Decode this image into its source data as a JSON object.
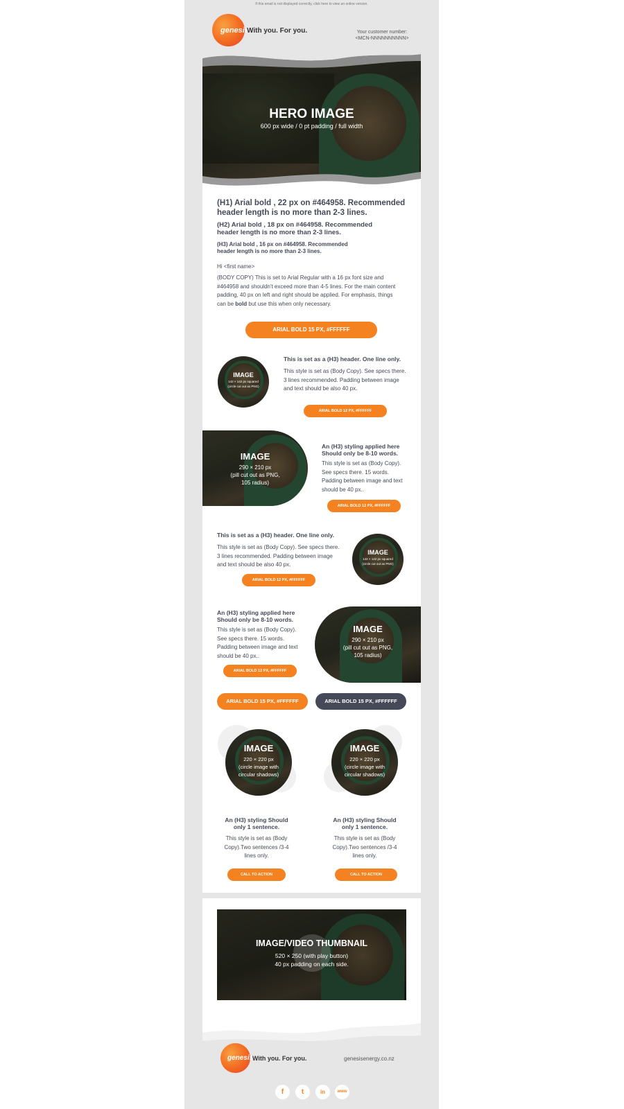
{
  "preheader": "If this email is not displayed correctly, click here to view an online version.",
  "brand": {
    "logo_text": "genesis",
    "tagline": "With you. For you.",
    "orange": "#f58220",
    "slate": "#464958"
  },
  "customer": {
    "label": "Your customer number:",
    "value": "<MCN-NNNNNNNNNN>"
  },
  "hero": {
    "title": "HERO IMAGE",
    "subtitle": "600 px wide / 0 pt padding / full width"
  },
  "headings": {
    "h1": "(H1) Arial bold , 22 px on #464958. Recommended header length is no more than 2-3 lines.",
    "h2": "(H2) Arial bold , 18 px on #464958. Recommended header length is no more than 2-3 lines.",
    "h3": "(H3) Arial bold , 16 px on #464958. Recommended header length is no more than 2-3 lines."
  },
  "greeting": "Hi <first name>",
  "body": {
    "before_bold": "(BODY COPY) This is set to Arial Regular with a 16 px font size and #464958 and shouldn't exceed more than 4-5 lines. For the main content padding, 40 px on left and right should be applied. For emphasis, things can be ",
    "bold": "bold",
    "after_bold": " but use this when only necessary."
  },
  "main_cta": "ARIAL BOLD 15 PX, #FFFFFF",
  "row1": {
    "img_title": "IMAGE",
    "img_sub1": "142 × 142 px squared",
    "img_sub2": "(circle cut out as PNG)",
    "h3": "This is set as a (H3) header. One line only.",
    "body": "This style is set as (Body Copy). See specs there. 3 lines recommended. Padding between image and text should be also 40 px.",
    "cta": "ARIAL BOLD 12 PX, #FFFFFF"
  },
  "row2": {
    "img_title": "IMAGE",
    "img_sub1": "290 × 210 px",
    "img_sub2": "(pill cut out as PNG,",
    "img_sub3": "105 radius)",
    "h3": "An (H3) styling applied here Should only be 8-10 words.",
    "body": "This style is set as (Body Copy). See specs there. 15 words. Padding between image and text should be 40 px..",
    "cta": "ARIAL BOLD 12 PX, #FFFFFF"
  },
  "row3": {
    "img_title": "IMAGE",
    "img_sub1": "142 × 142 px squared",
    "img_sub2": "(circle cut out as PNG)",
    "h3": "This is set as a (H3) header. One line only.",
    "body": "This style is set as (Body Copy). See specs there. 3 lines recommended. Padding between image and text should be also 40 px.",
    "cta": "ARIAL BOLD 12 PX, #FFFFFF"
  },
  "row4": {
    "img_title": "IMAGE",
    "img_sub1": "290 × 210 px",
    "img_sub2": "(pill cut out as PNG,",
    "img_sub3": "105 radius)",
    "h3": "An (H3) styling applied here Should only be 8-10 words.",
    "body": "This style is set as (Body Copy). See specs there. 15 words. Padding between image and text should be 40 px..",
    "cta": "ARIAL BOLD 12 PX, #FFFFFF"
  },
  "dual_buttons": {
    "primary": "ARIAL BOLD 15 PX, #FFFFFF",
    "secondary": "ARIAL BOLD 15 PX, #FFFFFF"
  },
  "columns": [
    {
      "img_title": "IMAGE",
      "img_sub1": "220 × 220 px",
      "img_sub2": "(circle image with",
      "img_sub3": "circular shadows)",
      "h3": "An (H3) styling Should only 1 sentence.",
      "body": "This style is set as (Body Copy).Two sentences /3-4 lines only.",
      "cta": "CALL TO ACTION"
    },
    {
      "img_title": "IMAGE",
      "img_sub1": "220 × 220 px",
      "img_sub2": "(circle image with",
      "img_sub3": "circular shadows)",
      "h3": "An (H3) styling Should only 1 sentence.",
      "body": "This style is set as (Body Copy).Two sentences /3-4 lines only.",
      "cta": "CALL TO ACTION"
    }
  ],
  "video": {
    "title": "IMAGE/VIDEO THUMBNAIL",
    "sub1": "520 × 250 (with play button)",
    "sub2": "40 px padding on each side."
  },
  "footer": {
    "logo_text": "genesis",
    "tagline": "With you. For you.",
    "website": "genesisenergy.co.nz",
    "social": [
      "f",
      "t",
      "in",
      "www"
    ]
  }
}
